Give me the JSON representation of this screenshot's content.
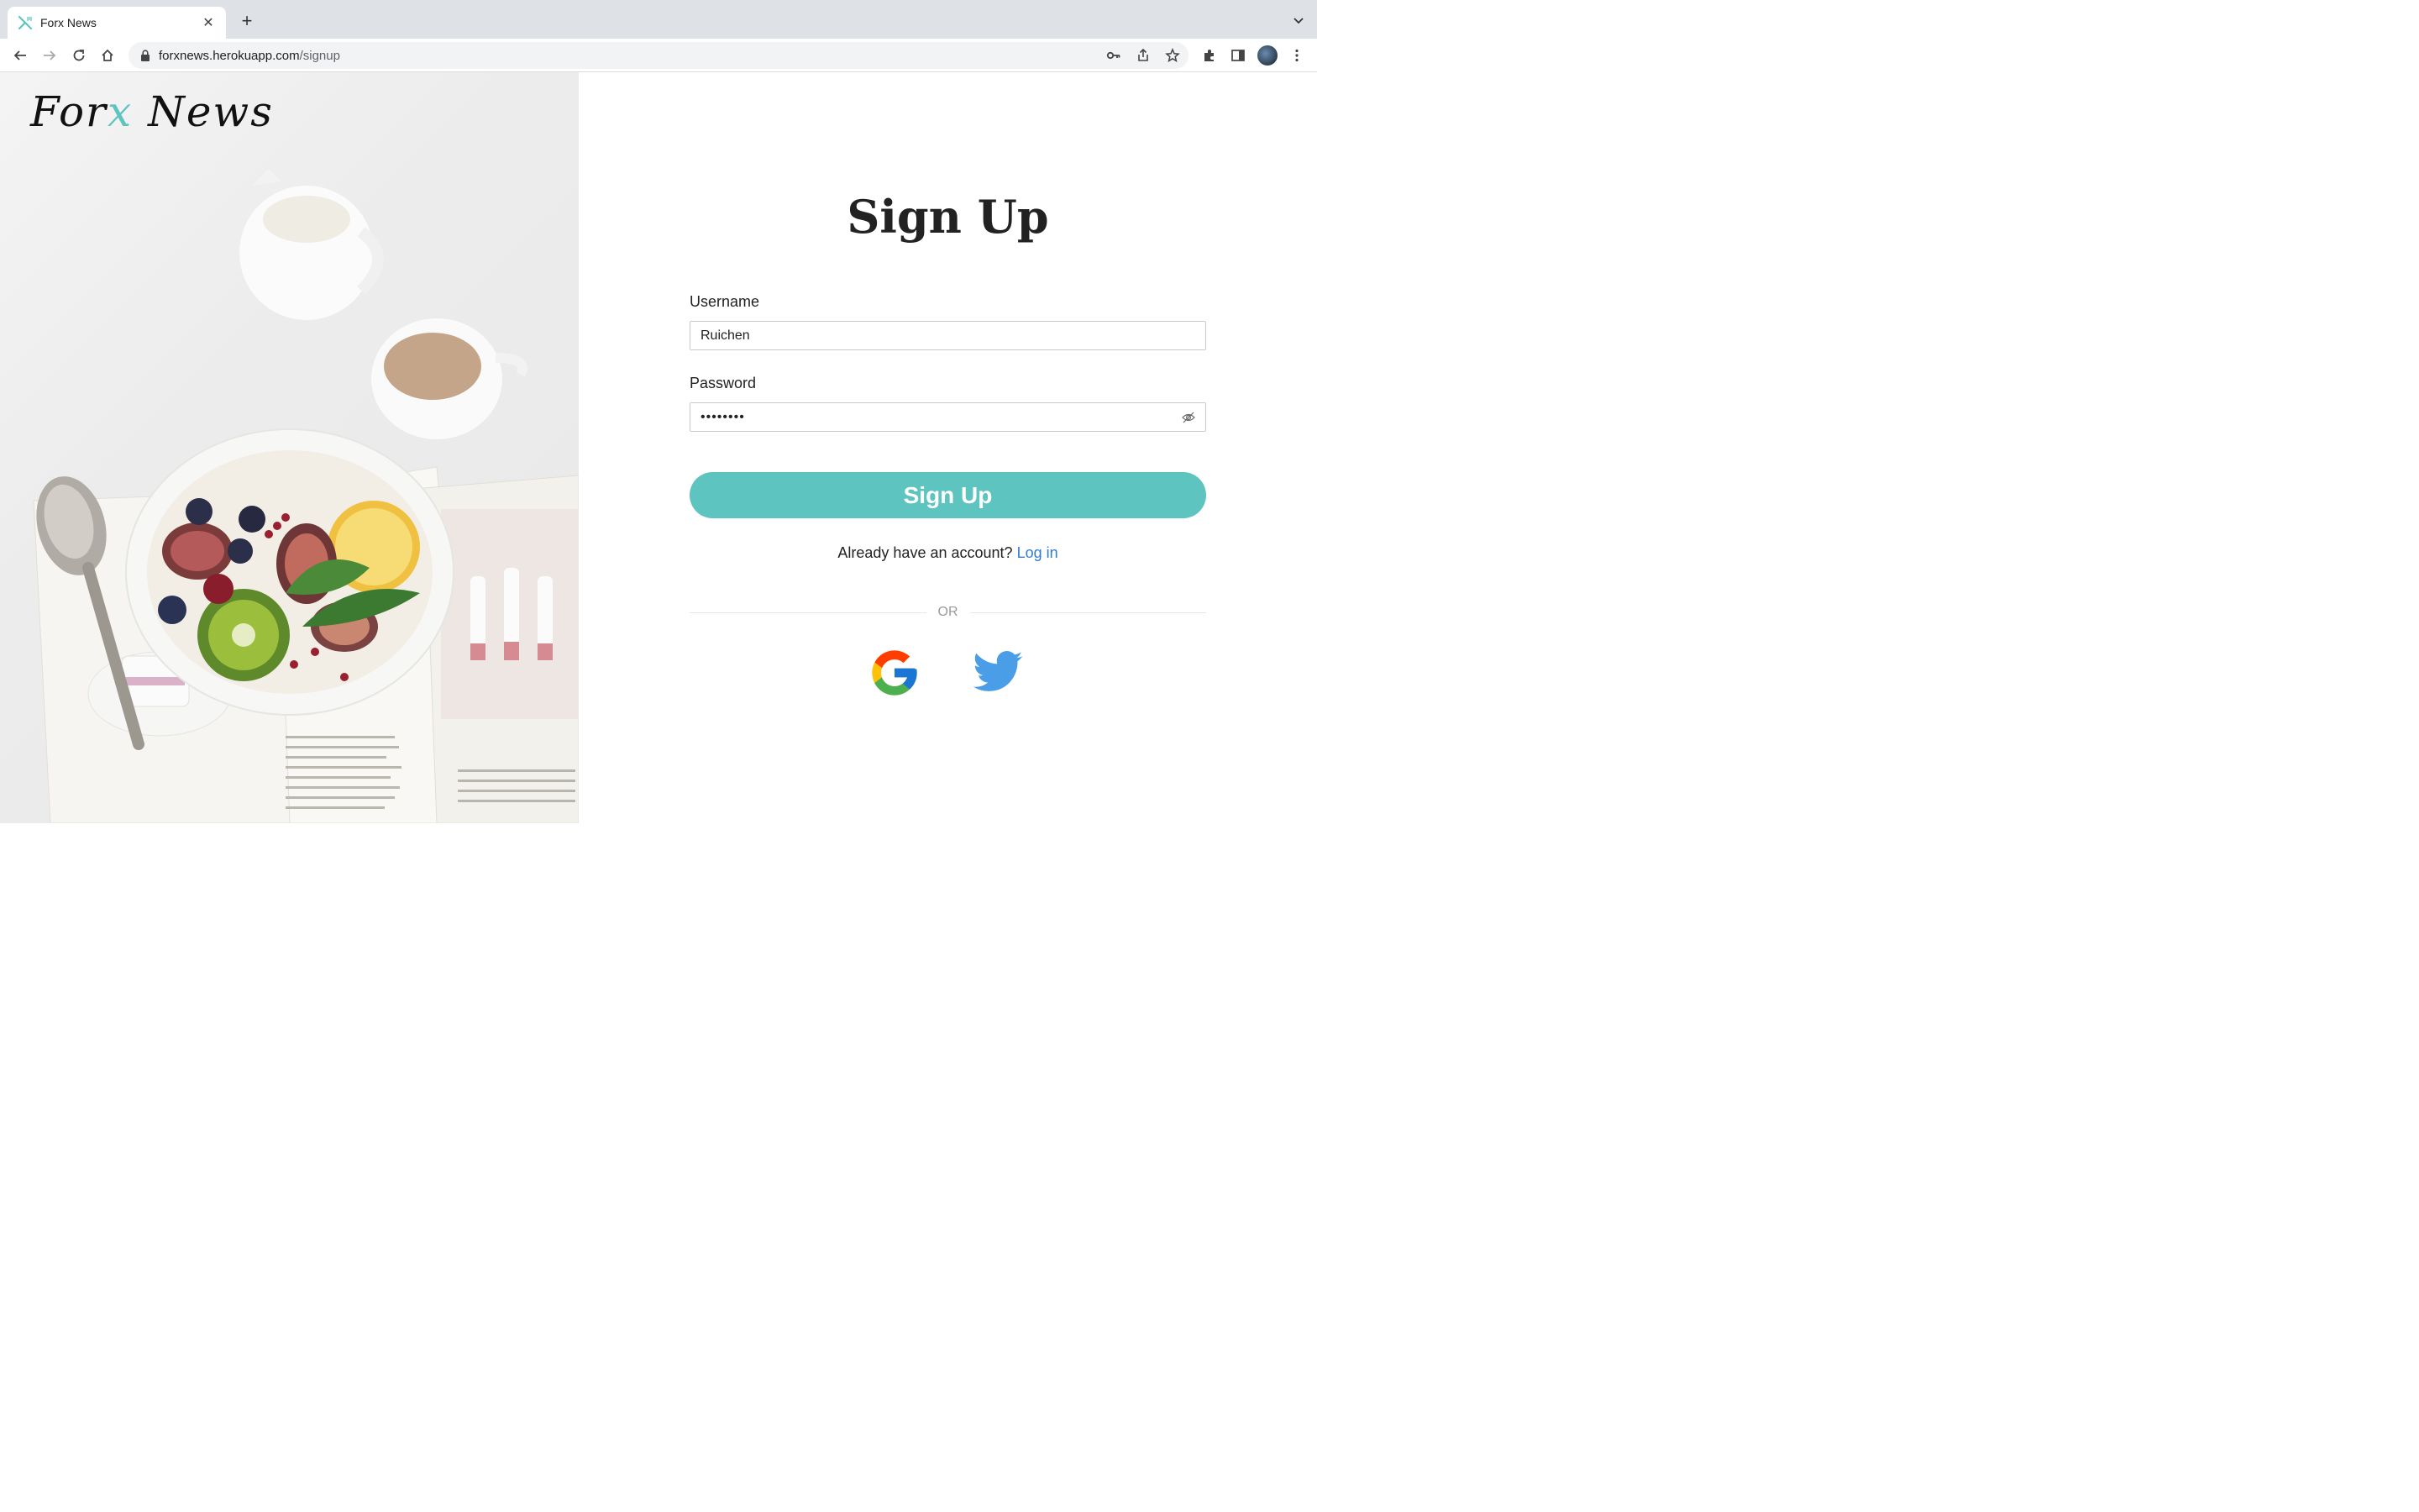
{
  "browser": {
    "tab_title": "Forx News",
    "url_host": "forxnews.herokuapp.com",
    "url_path": "/signup"
  },
  "brand": {
    "logo_prefix": "For",
    "logo_x": "x",
    "logo_suffix": " News",
    "accent": "#5ec4bf"
  },
  "form": {
    "heading": "Sign Up",
    "username_label": "Username",
    "username_value": "Ruichen",
    "password_label": "Password",
    "password_value": "••••••••",
    "submit_label": "Sign Up",
    "already_text": "Already have an account?",
    "login_link": "Log in",
    "divider_text": "OR"
  },
  "icons": {
    "social": [
      "google-icon",
      "twitter-icon"
    ]
  }
}
